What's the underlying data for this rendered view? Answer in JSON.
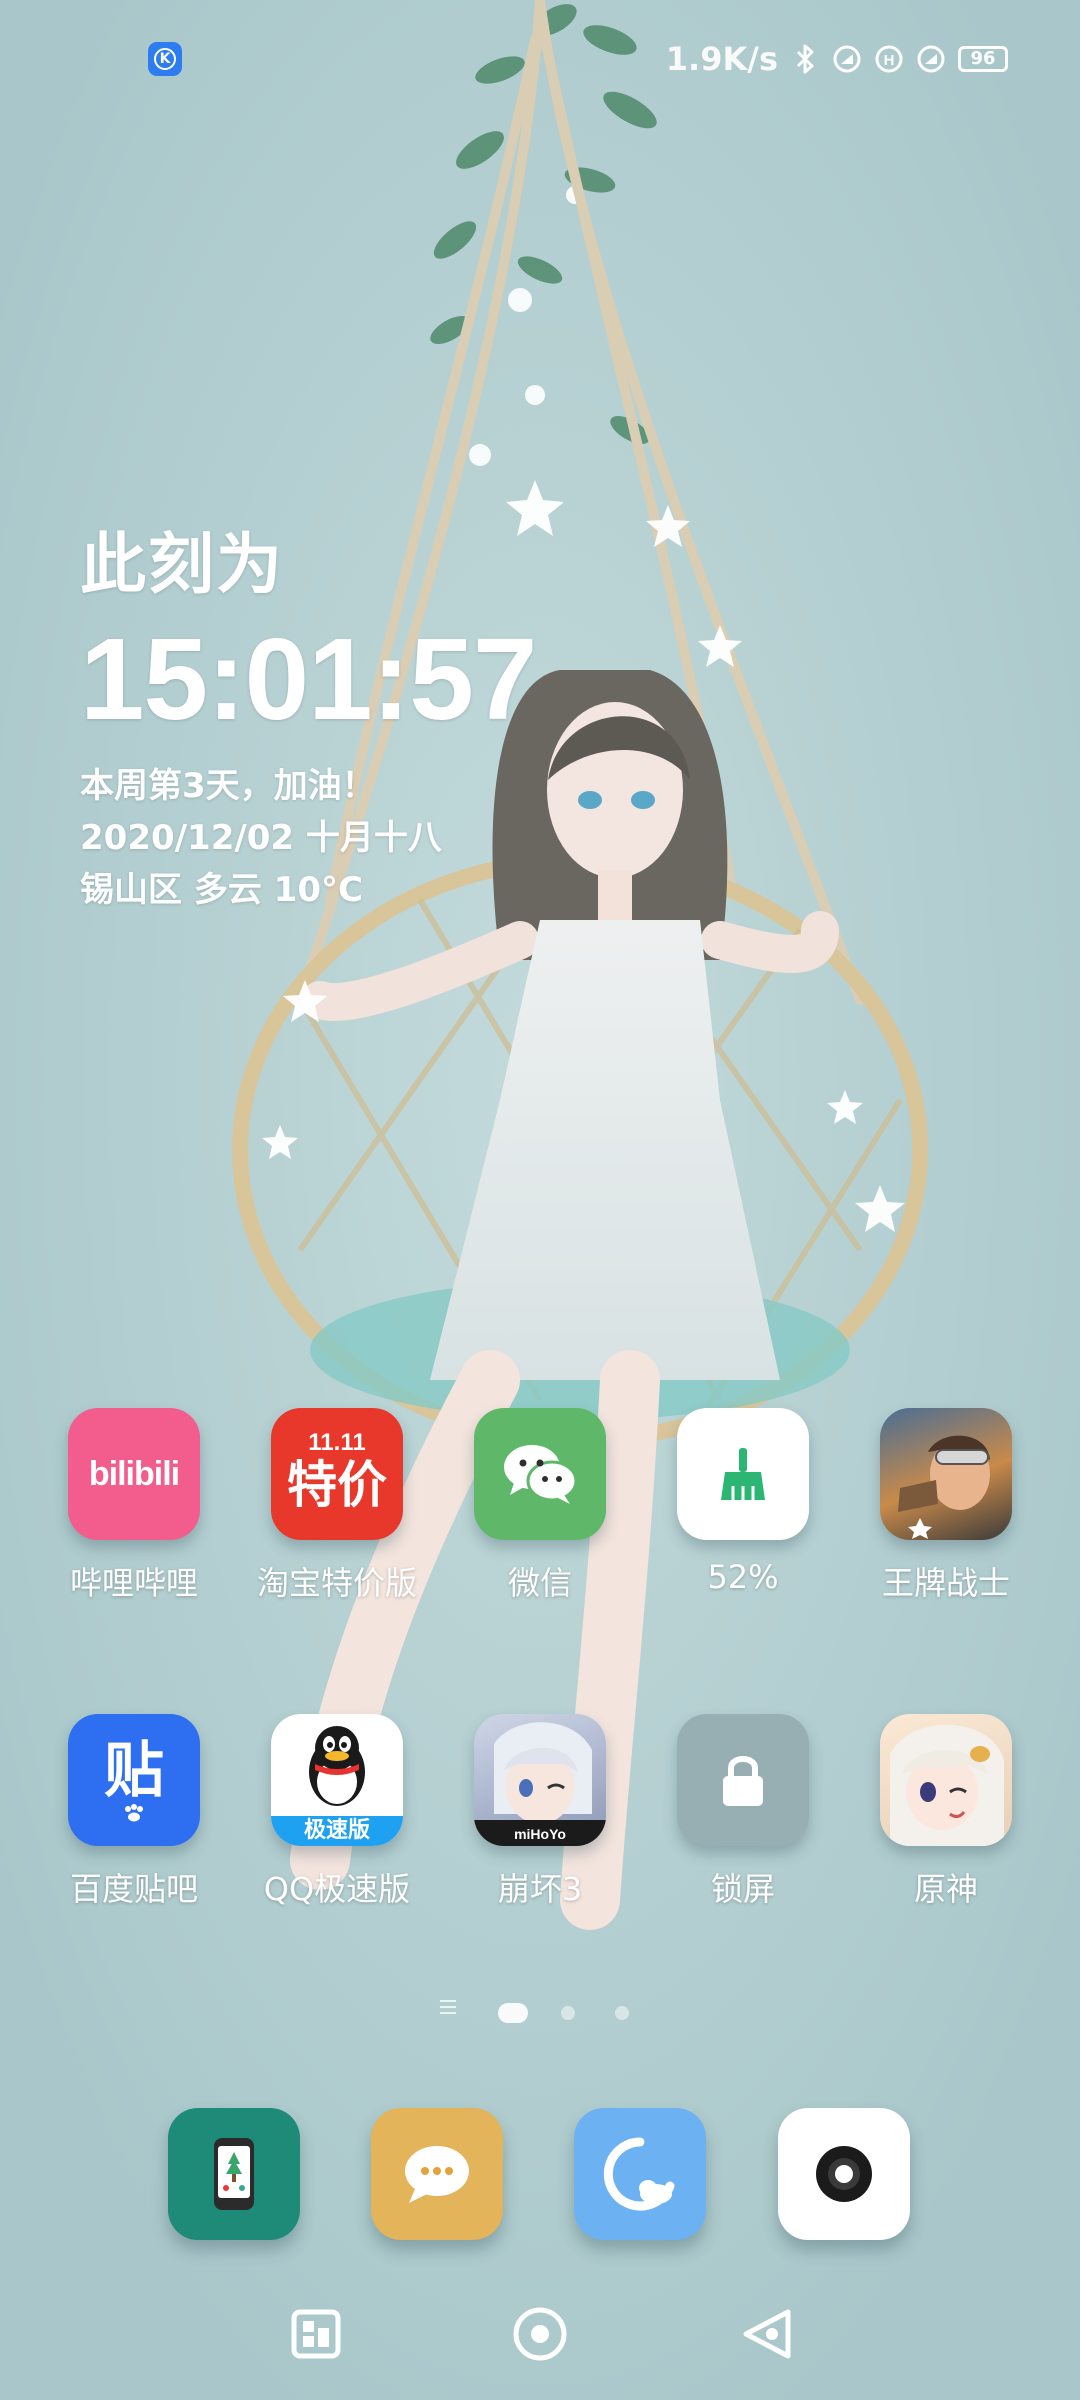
{
  "status_bar": {
    "network_speed": "1.9K/s",
    "battery_level": "96",
    "icons": [
      "k-app-icon",
      "bluetooth-icon",
      "signal-icon",
      "hd-icon",
      "signal-2-icon",
      "battery-icon"
    ]
  },
  "clock_widget": {
    "caption": "此刻为",
    "time": "15:01:57",
    "week_line": "本周第3天，加油！",
    "date_line": "2020/12/02 十月十八",
    "weather_line": "锡山区 多云 10°C"
  },
  "apps": [
    {
      "label": "哔哩哔哩",
      "icon": "bilibili-icon",
      "badge_text": "bilibili"
    },
    {
      "label": "淘宝特价版",
      "icon": "taobao-tejia-icon",
      "badge_top": "11.11",
      "badge_text": "特价"
    },
    {
      "label": "微信",
      "icon": "wechat-icon"
    },
    {
      "label": "52%",
      "icon": "cleaner-broom-icon"
    },
    {
      "label": "王牌战士",
      "icon": "hero-game-icon"
    },
    {
      "label": "百度贴吧",
      "icon": "tieba-icon",
      "badge_text": "贴"
    },
    {
      "label": "QQ极速版",
      "icon": "qq-penguin-icon",
      "badge_text": "极速版"
    },
    {
      "label": "崩坏3",
      "icon": "honkai3-icon"
    },
    {
      "label": "锁屏",
      "icon": "lock-icon"
    },
    {
      "label": "原神",
      "icon": "genshin-icon"
    }
  ],
  "dock": [
    {
      "name": "phone-app",
      "icon": "phone-icon"
    },
    {
      "name": "messages-app",
      "icon": "message-bubble-icon"
    },
    {
      "name": "browser-app",
      "icon": "browser-icon"
    },
    {
      "name": "camera-app",
      "icon": "camera-icon"
    }
  ],
  "pager": {
    "pages": 3,
    "active": 0
  },
  "colors": {
    "bilibili": "#f25d8e",
    "taobao": "#e8382b",
    "wechat": "#5fb86a",
    "tieba": "#2d6ff0",
    "phone": "#1e8a78",
    "messages": "#e3b45a",
    "browser": "#6cb2f2"
  }
}
